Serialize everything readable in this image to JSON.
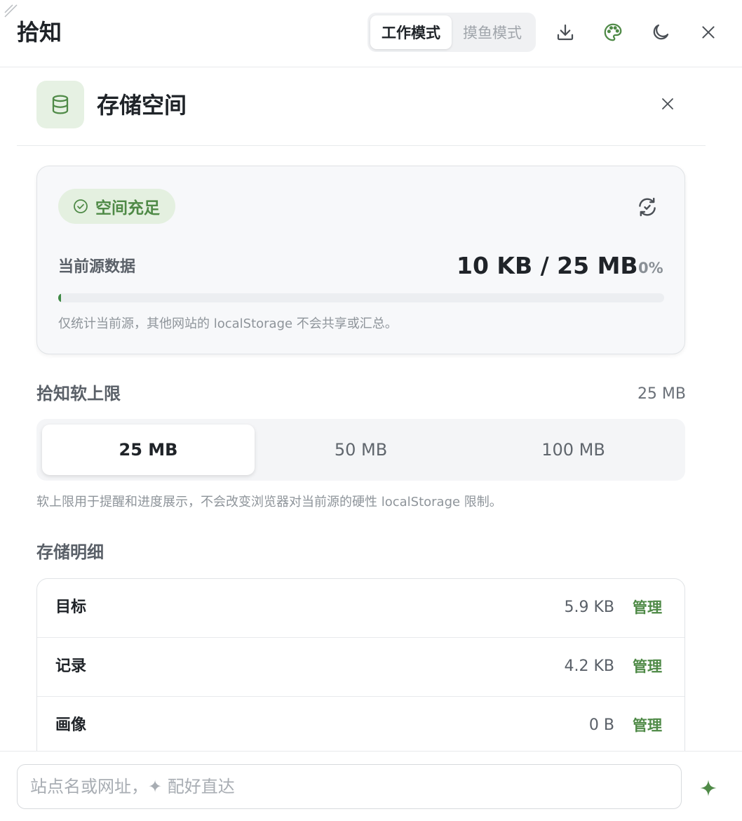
{
  "app": {
    "title": "拾知"
  },
  "modes": [
    {
      "label": "工作模式",
      "active": true
    },
    {
      "label": "摸鱼模式",
      "active": false
    }
  ],
  "toolbar_icons": [
    "download-icon",
    "palette-icon",
    "moon-icon",
    "close-icon"
  ],
  "panel": {
    "title": "存储空间",
    "icon": "database-icon"
  },
  "usage": {
    "status": "空间充足",
    "label": "当前源数据",
    "value": "10 KB / 25 MB",
    "percent_text": "0%",
    "progress_percent": 0.04,
    "note": "仅统计当前源，其他网站的 localStorage 不会共享或汇总。"
  },
  "soft_limit": {
    "title": "拾知软上限",
    "current": "25 MB",
    "options": [
      {
        "label": "25 MB",
        "active": true
      },
      {
        "label": "50 MB",
        "active": false
      },
      {
        "label": "100 MB",
        "active": false
      }
    ],
    "note": "软上限用于提醒和进度展示，不会改变浏览器对当前源的硬性 localStorage 限制。"
  },
  "details": {
    "title": "存储明细",
    "rows": [
      {
        "name": "目标",
        "size": "5.9 KB",
        "action": "管理"
      },
      {
        "name": "记录",
        "size": "4.2 KB",
        "action": "管理"
      },
      {
        "name": "画像",
        "size": "0 B",
        "action": "管理"
      }
    ]
  },
  "search": {
    "placeholder": "站点名或网址，✦ 配好直达",
    "value": ""
  },
  "colors": {
    "accent": "#4f8a47",
    "accent_bg": "#e4f0e0"
  }
}
